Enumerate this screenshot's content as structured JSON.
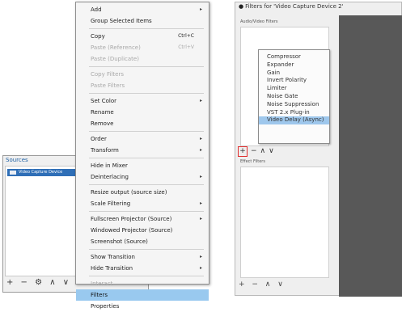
{
  "context_menu": {
    "items": [
      {
        "type": "item",
        "label": "Add",
        "submenu": true
      },
      {
        "type": "item",
        "label": "Group Selected Items"
      },
      {
        "type": "sep"
      },
      {
        "type": "item",
        "label": "Copy",
        "shortcut": "Ctrl+C"
      },
      {
        "type": "item",
        "label": "Paste (Reference)",
        "shortcut": "Ctrl+V",
        "disabled": true
      },
      {
        "type": "item",
        "label": "Paste (Duplicate)",
        "disabled": true
      },
      {
        "type": "sep"
      },
      {
        "type": "item",
        "label": "Copy Filters",
        "disabled": true
      },
      {
        "type": "item",
        "label": "Paste Filters",
        "disabled": true
      },
      {
        "type": "sep"
      },
      {
        "type": "item",
        "label": "Set Color",
        "submenu": true
      },
      {
        "type": "item",
        "label": "Rename"
      },
      {
        "type": "item",
        "label": "Remove"
      },
      {
        "type": "sep"
      },
      {
        "type": "item",
        "label": "Order",
        "submenu": true
      },
      {
        "type": "item",
        "label": "Transform",
        "submenu": true
      },
      {
        "type": "sep"
      },
      {
        "type": "item",
        "label": "Hide in Mixer"
      },
      {
        "type": "item",
        "label": "Deinterlacing",
        "submenu": true
      },
      {
        "type": "sep"
      },
      {
        "type": "item",
        "label": "Resize output (source size)"
      },
      {
        "type": "item",
        "label": "Scale Filtering",
        "submenu": true
      },
      {
        "type": "sep"
      },
      {
        "type": "item",
        "label": "Fullscreen Projector (Source)",
        "submenu": true
      },
      {
        "type": "item",
        "label": "Windowed Projector (Source)"
      },
      {
        "type": "item",
        "label": "Screenshot (Source)"
      },
      {
        "type": "sep"
      },
      {
        "type": "item",
        "label": "Show Transition",
        "submenu": true
      },
      {
        "type": "item",
        "label": "Hide Transition",
        "submenu": true
      },
      {
        "type": "sep"
      },
      {
        "type": "item",
        "label": "Interact",
        "disabled": true
      },
      {
        "type": "item",
        "label": "Filters",
        "selected": true
      },
      {
        "type": "item",
        "label": "Properties"
      }
    ]
  },
  "sources": {
    "title": "Sources",
    "item": "Video Capture Device",
    "toolbar": "+ − ⚙ ∧ ∨"
  },
  "filters_window": {
    "title": "Filters for 'Video Capture Device 2'",
    "audio_video_filters_label": "Audio/Video Filters",
    "effect_filters_label": "Effect Filters",
    "add_menu": [
      "Compressor",
      "Expander",
      "Gain",
      "Invert Polarity",
      "Limiter",
      "Noise Gate",
      "Noise Suppression",
      "VST 2.x Plug-in",
      "Video Delay (Async)"
    ],
    "add_menu_selected": 8,
    "add_button": "+",
    "remove_button": "−",
    "up_button": "∧",
    "down_button": "∨",
    "effect_toolbar": "+ − ∧ ∨"
  }
}
